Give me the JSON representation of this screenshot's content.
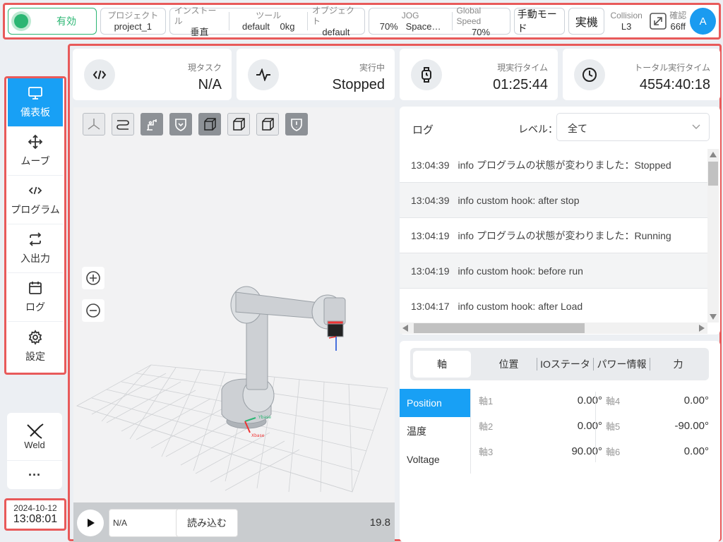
{
  "topbar": {
    "status": "有効",
    "project": {
      "caption": "プロジェクト",
      "value": "project_1"
    },
    "install": {
      "caption": "インストール",
      "value": "垂直"
    },
    "tool": {
      "caption": "ツール",
      "name": "default",
      "weight": "0kg"
    },
    "object": {
      "caption": "オブジェクト",
      "value": "default"
    },
    "jog": {
      "caption": "JOG",
      "speed": "70%",
      "frame": "Space…"
    },
    "global_speed": {
      "caption": "Global Speed",
      "value": "70%"
    },
    "manual_mode": "手動モード",
    "real_robot": "実機",
    "collision": {
      "caption": "Collision",
      "value": "L3"
    },
    "confirm": {
      "caption": "確認",
      "value": "66ff"
    },
    "avatar": "A"
  },
  "sidebar": {
    "items": [
      {
        "label": "儀表板",
        "icon": "monitor-icon"
      },
      {
        "label": "ムーブ",
        "icon": "move-arrows-icon"
      },
      {
        "label": "プログラム",
        "icon": "code-icon"
      },
      {
        "label": "入出力",
        "icon": "exchange-icon"
      },
      {
        "label": "ログ",
        "icon": "calendar-icon"
      },
      {
        "label": "設定",
        "icon": "gear-icon"
      }
    ],
    "weld": "Weld",
    "more": "···",
    "date": "2024-10-12",
    "time": "13:08:01"
  },
  "stats": {
    "task": {
      "caption": "現タスク",
      "value": "N/A"
    },
    "state": {
      "caption": "実行中",
      "value": "Stopped"
    },
    "runtime": {
      "caption": "現実行タイム",
      "value": "01:25:44"
    },
    "total": {
      "caption": "トータル実行タイム",
      "value": "4554:40:18"
    }
  },
  "viewer": {
    "program": "N/A",
    "load": "読み込む",
    "fps": "19.8",
    "axis_x": "Xbase",
    "axis_y": "Ybase"
  },
  "log": {
    "title": "ログ",
    "level_label": "レベル：",
    "level_value": "全て",
    "entries": [
      {
        "time": "13:04:39",
        "text": "info  プログラムの状態が変わりました：Stopped"
      },
      {
        "time": "13:04:39",
        "text": "info custom hook: after stop"
      },
      {
        "time": "13:04:19",
        "text": "info  プログラムの状態が変わりました：Running"
      },
      {
        "time": "13:04:19",
        "text": "info custom hook: before run"
      },
      {
        "time": "13:04:17",
        "text": "info custom hook: after Load"
      }
    ]
  },
  "joints": {
    "tabs": [
      "軸",
      "位置",
      "IOステータ",
      "パワー情報",
      "力"
    ],
    "subtabs": [
      "Position",
      "温度",
      "Voltage"
    ],
    "left": [
      {
        "name": "軸1",
        "value": "0.00°"
      },
      {
        "name": "軸2",
        "value": "0.00°"
      },
      {
        "name": "軸3",
        "value": "90.00°"
      }
    ],
    "right": [
      {
        "name": "軸4",
        "value": "0.00°"
      },
      {
        "name": "軸5",
        "value": "-90.00°"
      },
      {
        "name": "軸6",
        "value": "0.00°"
      }
    ]
  },
  "colors": {
    "accent": "#18a0f5",
    "status_green": "#2bb673",
    "highlight_frame": "#e85a5a"
  }
}
